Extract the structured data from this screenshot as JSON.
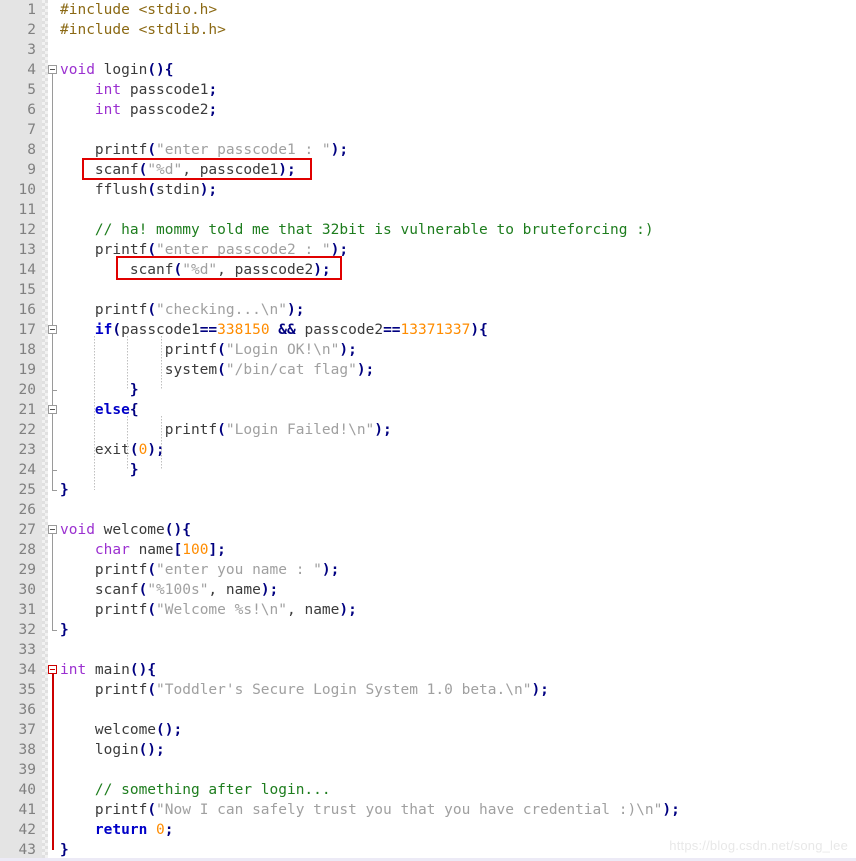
{
  "editor": {
    "title": "C source code viewer",
    "language": "C",
    "watermark": "https://blog.csdn.net/song_lee",
    "first_line": 1,
    "last_line": 43,
    "total_lines": 43,
    "colors": {
      "background": "#ffffff",
      "gutter_background": "#e4e4e4",
      "line_number": "#808080",
      "preprocessor": "#8b6914",
      "type": "#9b30d0",
      "keyword": "#0000c8",
      "operator": "#000080",
      "identifier": "#3b3b3b",
      "string": "#a0a0a0",
      "number": "#ff8c00",
      "comment": "#1e7d1e",
      "highlight_box": "#e00000"
    }
  },
  "line_numbers": [
    "1",
    "2",
    "3",
    "4",
    "5",
    "6",
    "7",
    "8",
    "9",
    "10",
    "11",
    "12",
    "13",
    "14",
    "15",
    "16",
    "17",
    "18",
    "19",
    "20",
    "21",
    "22",
    "23",
    "24",
    "25",
    "26",
    "27",
    "28",
    "29",
    "30",
    "31",
    "32",
    "33",
    "34",
    "35",
    "36",
    "37",
    "38",
    "39",
    "40",
    "41",
    "42",
    "43"
  ],
  "code_lines": [
    {
      "n": 1,
      "text": "#include <stdio.h>"
    },
    {
      "n": 2,
      "text": "#include <stdlib.h>"
    },
    {
      "n": 3,
      "text": ""
    },
    {
      "n": 4,
      "text": "void login(){"
    },
    {
      "n": 5,
      "text": "    int passcode1;"
    },
    {
      "n": 6,
      "text": "    int passcode2;"
    },
    {
      "n": 7,
      "text": ""
    },
    {
      "n": 8,
      "text": "    printf(\"enter passcode1 : \");"
    },
    {
      "n": 9,
      "text": "    scanf(\"%d\", passcode1);"
    },
    {
      "n": 10,
      "text": "    fflush(stdin);"
    },
    {
      "n": 11,
      "text": ""
    },
    {
      "n": 12,
      "text": "    // ha! mommy told me that 32bit is vulnerable to bruteforcing :)"
    },
    {
      "n": 13,
      "text": "    printf(\"enter passcode2 : \");"
    },
    {
      "n": 14,
      "text": "        scanf(\"%d\", passcode2);"
    },
    {
      "n": 15,
      "text": ""
    },
    {
      "n": 16,
      "text": "    printf(\"checking...\\n\");"
    },
    {
      "n": 17,
      "text": "    if(passcode1==338150 && passcode2==13371337){"
    },
    {
      "n": 18,
      "text": "            printf(\"Login OK!\\n\");"
    },
    {
      "n": 19,
      "text": "            system(\"/bin/cat flag\");"
    },
    {
      "n": 20,
      "text": "        }"
    },
    {
      "n": 21,
      "text": "    else{"
    },
    {
      "n": 22,
      "text": "            printf(\"Login Failed!\\n\");"
    },
    {
      "n": 23,
      "text": "    exit(0);"
    },
    {
      "n": 24,
      "text": "        }"
    },
    {
      "n": 25,
      "text": "}"
    },
    {
      "n": 26,
      "text": ""
    },
    {
      "n": 27,
      "text": "void welcome(){"
    },
    {
      "n": 28,
      "text": "    char name[100];"
    },
    {
      "n": 29,
      "text": "    printf(\"enter you name : \");"
    },
    {
      "n": 30,
      "text": "    scanf(\"%100s\", name);"
    },
    {
      "n": 31,
      "text": "    printf(\"Welcome %s!\\n\", name);"
    },
    {
      "n": 32,
      "text": "}"
    },
    {
      "n": 33,
      "text": ""
    },
    {
      "n": 34,
      "text": "int main(){"
    },
    {
      "n": 35,
      "text": "    printf(\"Toddler's Secure Login System 1.0 beta.\\n\");"
    },
    {
      "n": 36,
      "text": ""
    },
    {
      "n": 37,
      "text": "    welcome();"
    },
    {
      "n": 38,
      "text": "    login();"
    },
    {
      "n": 39,
      "text": ""
    },
    {
      "n": 40,
      "text": "    // something after login..."
    },
    {
      "n": 41,
      "text": "    printf(\"Now I can safely trust you that you have credential :)\\n\");"
    },
    {
      "n": 42,
      "text": "    return 0;"
    },
    {
      "n": 43,
      "text": "}"
    }
  ],
  "tokens": [
    {
      "n": 1,
      "parts": [
        [
          "pre",
          "#include <stdio.h>"
        ]
      ]
    },
    {
      "n": 2,
      "parts": [
        [
          "pre",
          "#include <stdlib.h>"
        ]
      ]
    },
    {
      "n": 3,
      "parts": []
    },
    {
      "n": 4,
      "parts": [
        [
          "type",
          "void"
        ],
        [
          "fn",
          " login"
        ],
        [
          "op",
          "(){"
        ]
      ]
    },
    {
      "n": 5,
      "parts": [
        [
          "fn",
          "    "
        ],
        [
          "type",
          "int"
        ],
        [
          "fn",
          " passcode1"
        ],
        [
          "op",
          ";"
        ]
      ]
    },
    {
      "n": 6,
      "parts": [
        [
          "fn",
          "    "
        ],
        [
          "type",
          "int"
        ],
        [
          "fn",
          " passcode2"
        ],
        [
          "op",
          ";"
        ]
      ]
    },
    {
      "n": 7,
      "parts": []
    },
    {
      "n": 8,
      "parts": [
        [
          "fn",
          "    printf"
        ],
        [
          "op",
          "("
        ],
        [
          "str",
          "\"enter passcode1 : \""
        ],
        [
          "op",
          ");"
        ]
      ]
    },
    {
      "n": 9,
      "parts": [
        [
          "fn",
          "    scanf"
        ],
        [
          "op",
          "("
        ],
        [
          "str",
          "\"%d\""
        ],
        [
          "fn",
          ", passcode1"
        ],
        [
          "op",
          ");"
        ]
      ]
    },
    {
      "n": 10,
      "parts": [
        [
          "fn",
          "    fflush"
        ],
        [
          "op",
          "("
        ],
        [
          "fn",
          "stdin"
        ],
        [
          "op",
          ");"
        ]
      ]
    },
    {
      "n": 11,
      "parts": []
    },
    {
      "n": 12,
      "parts": [
        [
          "fn",
          "    "
        ],
        [
          "com",
          "// ha! mommy told me that 32bit is vulnerable to bruteforcing :)"
        ]
      ]
    },
    {
      "n": 13,
      "parts": [
        [
          "fn",
          "    printf"
        ],
        [
          "op",
          "("
        ],
        [
          "str",
          "\"enter passcode2 : \""
        ],
        [
          "op",
          ");"
        ]
      ]
    },
    {
      "n": 14,
      "parts": [
        [
          "fn",
          "        scanf"
        ],
        [
          "op",
          "("
        ],
        [
          "str",
          "\"%d\""
        ],
        [
          "fn",
          ", passcode2"
        ],
        [
          "op",
          ");"
        ]
      ]
    },
    {
      "n": 15,
      "parts": []
    },
    {
      "n": 16,
      "parts": [
        [
          "fn",
          "    printf"
        ],
        [
          "op",
          "("
        ],
        [
          "str",
          "\"checking...\\n\""
        ],
        [
          "op",
          ");"
        ]
      ]
    },
    {
      "n": 17,
      "parts": [
        [
          "fn",
          "    "
        ],
        [
          "kw",
          "if"
        ],
        [
          "op",
          "("
        ],
        [
          "fn",
          "passcode1"
        ],
        [
          "op",
          "=="
        ],
        [
          "num",
          "338150"
        ],
        [
          "fn",
          " "
        ],
        [
          "op",
          "&&"
        ],
        [
          "fn",
          " passcode2"
        ],
        [
          "op",
          "=="
        ],
        [
          "num",
          "13371337"
        ],
        [
          "op",
          "){"
        ]
      ]
    },
    {
      "n": 18,
      "parts": [
        [
          "fn",
          "            printf"
        ],
        [
          "op",
          "("
        ],
        [
          "str",
          "\"Login OK!\\n\""
        ],
        [
          "op",
          ");"
        ]
      ]
    },
    {
      "n": 19,
      "parts": [
        [
          "fn",
          "            system"
        ],
        [
          "op",
          "("
        ],
        [
          "str",
          "\"/bin/cat flag\""
        ],
        [
          "op",
          ");"
        ]
      ]
    },
    {
      "n": 20,
      "parts": [
        [
          "op",
          "        }"
        ]
      ]
    },
    {
      "n": 21,
      "parts": [
        [
          "fn",
          "    "
        ],
        [
          "kw",
          "else"
        ],
        [
          "op",
          "{"
        ]
      ]
    },
    {
      "n": 22,
      "parts": [
        [
          "fn",
          "            printf"
        ],
        [
          "op",
          "("
        ],
        [
          "str",
          "\"Login Failed!\\n\""
        ],
        [
          "op",
          ");"
        ]
      ]
    },
    {
      "n": 23,
      "parts": [
        [
          "fn",
          "    exit"
        ],
        [
          "op",
          "("
        ],
        [
          "num",
          "0"
        ],
        [
          "op",
          ");"
        ]
      ]
    },
    {
      "n": 24,
      "parts": [
        [
          "op",
          "        }"
        ]
      ]
    },
    {
      "n": 25,
      "parts": [
        [
          "op",
          "}"
        ]
      ]
    },
    {
      "n": 26,
      "parts": []
    },
    {
      "n": 27,
      "parts": [
        [
          "type",
          "void"
        ],
        [
          "fn",
          " welcome"
        ],
        [
          "op",
          "(){"
        ]
      ]
    },
    {
      "n": 28,
      "parts": [
        [
          "fn",
          "    "
        ],
        [
          "type",
          "char"
        ],
        [
          "fn",
          " name"
        ],
        [
          "op",
          "["
        ],
        [
          "num",
          "100"
        ],
        [
          "op",
          "];"
        ]
      ]
    },
    {
      "n": 29,
      "parts": [
        [
          "fn",
          "    printf"
        ],
        [
          "op",
          "("
        ],
        [
          "str",
          "\"enter you name : \""
        ],
        [
          "op",
          ");"
        ]
      ]
    },
    {
      "n": 30,
      "parts": [
        [
          "fn",
          "    scanf"
        ],
        [
          "op",
          "("
        ],
        [
          "str",
          "\"%100s\""
        ],
        [
          "fn",
          ", name"
        ],
        [
          "op",
          ");"
        ]
      ]
    },
    {
      "n": 31,
      "parts": [
        [
          "fn",
          "    printf"
        ],
        [
          "op",
          "("
        ],
        [
          "str",
          "\"Welcome %s!\\n\""
        ],
        [
          "fn",
          ", name"
        ],
        [
          "op",
          ");"
        ]
      ]
    },
    {
      "n": 32,
      "parts": [
        [
          "op",
          "}"
        ]
      ]
    },
    {
      "n": 33,
      "parts": []
    },
    {
      "n": 34,
      "parts": [
        [
          "type",
          "int"
        ],
        [
          "fn",
          " main"
        ],
        [
          "op",
          "(){"
        ]
      ]
    },
    {
      "n": 35,
      "parts": [
        [
          "fn",
          "    printf"
        ],
        [
          "op",
          "("
        ],
        [
          "str",
          "\"Toddler's Secure Login System 1.0 beta.\\n\""
        ],
        [
          "op",
          ");"
        ]
      ]
    },
    {
      "n": 36,
      "parts": []
    },
    {
      "n": 37,
      "parts": [
        [
          "fn",
          "    welcome"
        ],
        [
          "op",
          "();"
        ]
      ]
    },
    {
      "n": 38,
      "parts": [
        [
          "fn",
          "    login"
        ],
        [
          "op",
          "();"
        ]
      ]
    },
    {
      "n": 39,
      "parts": []
    },
    {
      "n": 40,
      "parts": [
        [
          "fn",
          "    "
        ],
        [
          "com",
          "// something after login..."
        ]
      ]
    },
    {
      "n": 41,
      "parts": [
        [
          "fn",
          "    printf"
        ],
        [
          "op",
          "("
        ],
        [
          "str",
          "\"Now I can safely trust you that you have credential :)\\n\""
        ],
        [
          "op",
          ");"
        ]
      ]
    },
    {
      "n": 42,
      "parts": [
        [
          "fn",
          "    "
        ],
        [
          "kw",
          "return"
        ],
        [
          "fn",
          " "
        ],
        [
          "num",
          "0"
        ],
        [
          "op",
          ";"
        ]
      ]
    },
    {
      "n": 43,
      "parts": [
        [
          "op",
          "}"
        ]
      ]
    }
  ],
  "fold_markers": [
    {
      "line": 4,
      "type": "open",
      "color": "gray"
    },
    {
      "line": 17,
      "type": "open",
      "color": "gray"
    },
    {
      "line": 21,
      "type": "open",
      "color": "gray"
    },
    {
      "line": 27,
      "type": "open",
      "color": "gray"
    },
    {
      "line": 34,
      "type": "open",
      "color": "red"
    }
  ],
  "highlight_boxes": [
    {
      "line": 9,
      "label": "scanf-passcode1-highlight"
    },
    {
      "line": 14,
      "label": "scanf-passcode2-highlight"
    }
  ]
}
